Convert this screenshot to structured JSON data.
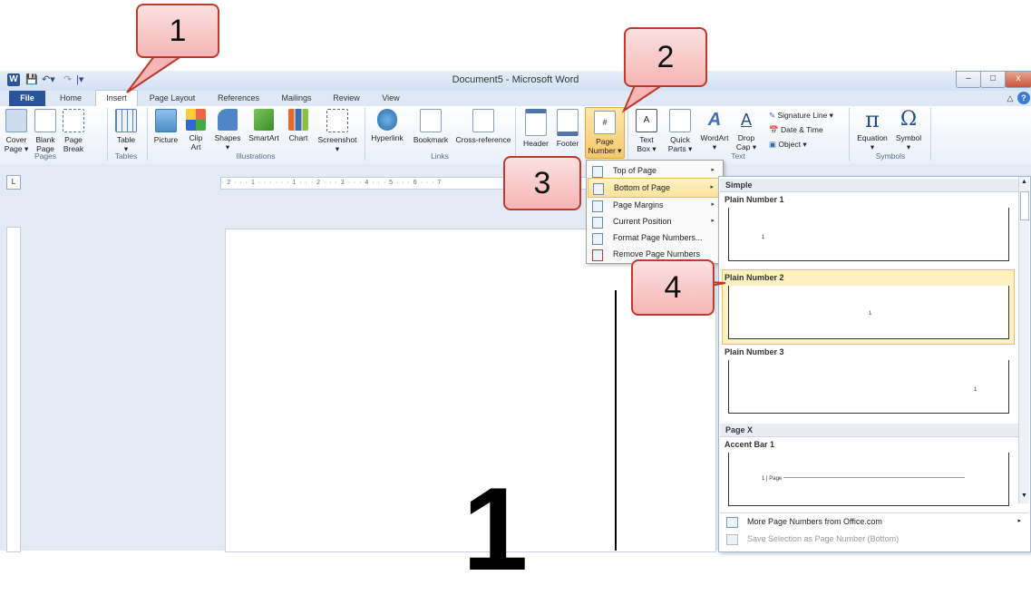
{
  "window": {
    "title": "Document5 - Microsoft Word",
    "app_icon_letter": "W",
    "controls": [
      "–",
      "□",
      "x"
    ],
    "help_glyph": "?"
  },
  "tabs": [
    "File",
    "Home",
    "Insert",
    "Page Layout",
    "References",
    "Mailings",
    "Review",
    "View"
  ],
  "ribbon": {
    "buttons": {
      "cover_page": "Cover\nPage ▾",
      "blank_page": "Blank\nPage",
      "page_break": "Page\nBreak",
      "table": "Table\n▾",
      "picture": "Picture",
      "clip_art": "Clip\nArt",
      "shapes": "Shapes\n▾",
      "smartart": "SmartArt",
      "chart": "Chart",
      "screenshot": "Screenshot\n▾",
      "hyperlink": "Hyperlink",
      "bookmark": "Bookmark",
      "cross_reference": "Cross-reference",
      "header": "Header",
      "footer": "Footer",
      "page_number": "Page\nNumber ▾",
      "text_box": "Text\nBox ▾",
      "quick_parts": "Quick\nParts ▾",
      "wordart": "WordArt\n▾",
      "drop_cap": "Drop\nCap ▾",
      "signature_line": "Signature Line ▾",
      "date_time": "Date & Time",
      "object": "Object ▾",
      "equation": "Equation\n▾",
      "symbol": "Symbol\n▾"
    },
    "groups": [
      "Pages",
      "Tables",
      "Illustrations",
      "Links",
      "Text",
      "Symbols"
    ]
  },
  "ruler": {
    "h_text": "· 2 · · · 1 · · · · · · 1 · · · 2 · · · 3 · · · 4 · · · 5 · · · 6 · · · 7",
    "button": "L"
  },
  "document": {
    "big_char": "1"
  },
  "page_number_menu": {
    "items": [
      {
        "label": "Top of Page",
        "arrow": "▸"
      },
      {
        "label": "Bottom of Page",
        "arrow": "▸"
      },
      {
        "label": "Page Margins",
        "arrow": "▸"
      },
      {
        "label": "Current Position",
        "arrow": "▸"
      },
      {
        "label": "Format Page Numbers..."
      },
      {
        "label": "Remove Page Numbers"
      }
    ]
  },
  "gallery": {
    "section_simple": "Simple",
    "plain1": "Plain Number 1",
    "plain2": "Plain Number 2",
    "plain3": "Plain Number 3",
    "section_pagex": "Page X",
    "accent1": "Accent Bar 1",
    "thumb_number": "1",
    "accent_text": "1 | Page",
    "more": "More Page Numbers from Office.com",
    "save": "Save Selection as Page Number (Bottom)",
    "more_arrow": "▸"
  },
  "callouts": [
    "1",
    "2",
    "3",
    "4"
  ],
  "colors": {
    "file_tab": "#2a5699",
    "highlight": "#fde29a",
    "callout_fill": "#f6b6b6",
    "callout_border": "#c0392b"
  }
}
